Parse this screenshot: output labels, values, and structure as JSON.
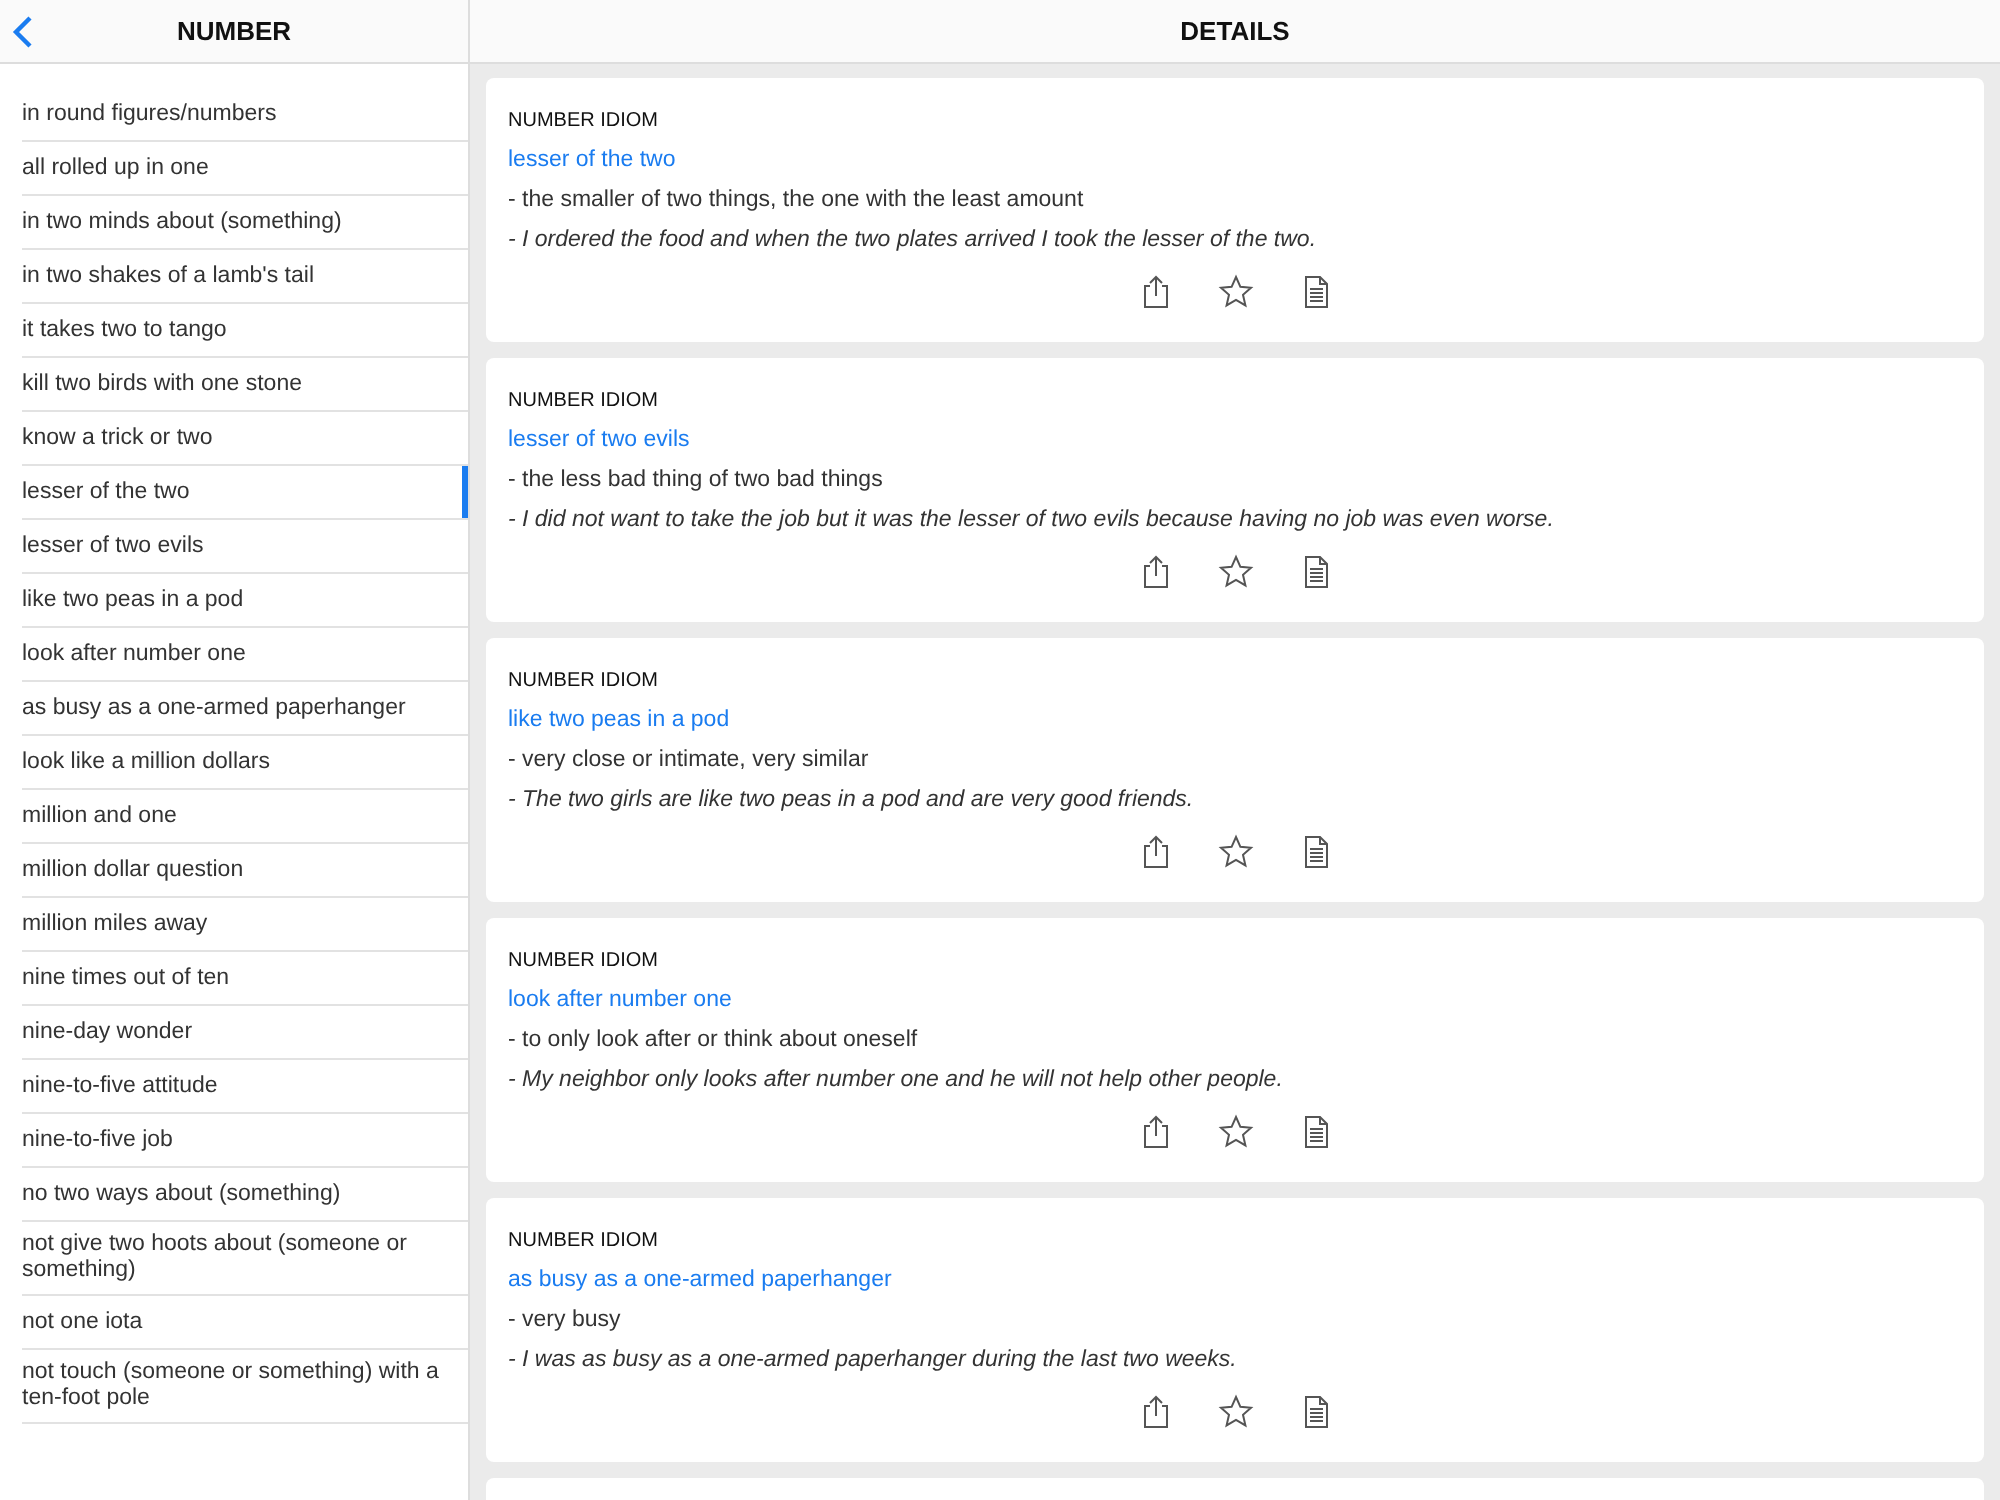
{
  "sidebar": {
    "title": "NUMBER",
    "items": [
      {
        "label": "in round figures/numbers",
        "selected": false
      },
      {
        "label": "all rolled up in one",
        "selected": false
      },
      {
        "label": "in two minds about (something)",
        "selected": false
      },
      {
        "label": "in two shakes of a lamb's tail",
        "selected": false
      },
      {
        "label": "it takes two to tango",
        "selected": false
      },
      {
        "label": "kill two birds with one stone",
        "selected": false
      },
      {
        "label": "know a trick or two",
        "selected": false
      },
      {
        "label": "lesser of the two",
        "selected": true
      },
      {
        "label": "lesser of two evils",
        "selected": false
      },
      {
        "label": "like two peas in a pod",
        "selected": false
      },
      {
        "label": "look after number one",
        "selected": false
      },
      {
        "label": "as busy as a one-armed paperhanger",
        "selected": false
      },
      {
        "label": "look like a million dollars",
        "selected": false
      },
      {
        "label": "million and one",
        "selected": false
      },
      {
        "label": "million dollar question",
        "selected": false
      },
      {
        "label": "million miles away",
        "selected": false
      },
      {
        "label": "nine times out of ten",
        "selected": false
      },
      {
        "label": "nine-day wonder",
        "selected": false
      },
      {
        "label": "nine-to-five attitude",
        "selected": false
      },
      {
        "label": "nine-to-five job",
        "selected": false
      },
      {
        "label": "no two ways about (something)",
        "selected": false
      },
      {
        "label": "not give two hoots about (someone or something)",
        "selected": false
      },
      {
        "label": "not one iota",
        "selected": false
      },
      {
        "label": "not touch (someone or something) with a ten-foot pole",
        "selected": false
      }
    ]
  },
  "details": {
    "title": "DETAILS",
    "cards": [
      {
        "category": "NUMBER IDIOM",
        "idiom": "lesser of the two",
        "definition": "- the smaller of two things, the one with the least amount",
        "example": "- I ordered the food and when the two plates arrived I took the lesser of the two."
      },
      {
        "category": "NUMBER IDIOM",
        "idiom": "lesser of two evils",
        "definition": "- the less bad thing of two bad things",
        "example": "- I did not want to take the job but it was the lesser of two evils because having no job was even worse."
      },
      {
        "category": "NUMBER IDIOM",
        "idiom": "like two peas in a pod",
        "definition": "- very close or intimate, very similar",
        "example": "- The two girls are like two peas in a pod and are very good friends."
      },
      {
        "category": "NUMBER IDIOM",
        "idiom": "look after number one",
        "definition": "- to only look after or think about oneself",
        "example": "- My neighbor only looks after number one and he will not help other people."
      },
      {
        "category": "NUMBER IDIOM",
        "idiom": "as busy as a one-armed paperhanger",
        "definition": "- very busy",
        "example": "- I was as busy as a one-armed paperhanger during the last two weeks."
      }
    ]
  }
}
